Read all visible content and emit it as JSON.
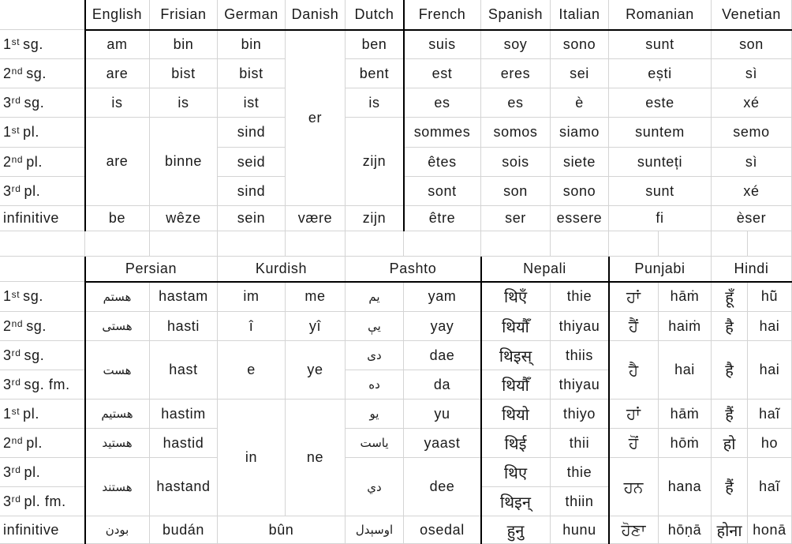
{
  "table1": {
    "row_labels": [
      {
        "num": "1",
        "sup": "st",
        "rest": "sg."
      },
      {
        "num": "2",
        "sup": "nd",
        "rest": "sg."
      },
      {
        "num": "3",
        "sup": "rd",
        "rest": "sg."
      },
      {
        "num": "1",
        "sup": "st",
        "rest": "pl."
      },
      {
        "num": "2",
        "sup": "nd",
        "rest": "pl."
      },
      {
        "num": "3",
        "sup": "rd",
        "rest": "pl."
      },
      {
        "num": "",
        "sup": "",
        "rest": "infinitive"
      }
    ],
    "headers": [
      "English",
      "Frisian",
      "German",
      "Danish",
      "Dutch",
      "French",
      "Spanish",
      "Italian",
      "Romanian",
      "Venetian"
    ],
    "cells": [
      {
        "r": 0,
        "c": 0,
        "rs": 1,
        "v": "am"
      },
      {
        "r": 1,
        "c": 0,
        "rs": 1,
        "v": "are"
      },
      {
        "r": 2,
        "c": 0,
        "rs": 1,
        "v": "is"
      },
      {
        "r": 3,
        "c": 0,
        "rs": 3,
        "v": "are"
      },
      {
        "r": 6,
        "c": 0,
        "rs": 1,
        "v": "be"
      },
      {
        "r": 0,
        "c": 1,
        "rs": 1,
        "v": "bin"
      },
      {
        "r": 1,
        "c": 1,
        "rs": 1,
        "v": "bist"
      },
      {
        "r": 2,
        "c": 1,
        "rs": 1,
        "v": "is"
      },
      {
        "r": 3,
        "c": 1,
        "rs": 3,
        "v": "binne"
      },
      {
        "r": 6,
        "c": 1,
        "rs": 1,
        "v": "wêze"
      },
      {
        "r": 0,
        "c": 2,
        "rs": 1,
        "v": "bin"
      },
      {
        "r": 1,
        "c": 2,
        "rs": 1,
        "v": "bist"
      },
      {
        "r": 2,
        "c": 2,
        "rs": 1,
        "v": "ist"
      },
      {
        "r": 3,
        "c": 2,
        "rs": 1,
        "v": "sind"
      },
      {
        "r": 4,
        "c": 2,
        "rs": 1,
        "v": "seid"
      },
      {
        "r": 5,
        "c": 2,
        "rs": 1,
        "v": "sind"
      },
      {
        "r": 6,
        "c": 2,
        "rs": 1,
        "v": "sein"
      },
      {
        "r": 0,
        "c": 3,
        "rs": 6,
        "v": "er"
      },
      {
        "r": 6,
        "c": 3,
        "rs": 1,
        "v": "være"
      },
      {
        "r": 0,
        "c": 4,
        "rs": 1,
        "v": "ben"
      },
      {
        "r": 1,
        "c": 4,
        "rs": 1,
        "v": "bent"
      },
      {
        "r": 2,
        "c": 4,
        "rs": 1,
        "v": "is"
      },
      {
        "r": 3,
        "c": 4,
        "rs": 3,
        "v": "zijn"
      },
      {
        "r": 6,
        "c": 4,
        "rs": 1,
        "v": "zijn"
      },
      {
        "r": 0,
        "c": 5,
        "rs": 1,
        "v": "suis"
      },
      {
        "r": 1,
        "c": 5,
        "rs": 1,
        "v": "est"
      },
      {
        "r": 2,
        "c": 5,
        "rs": 1,
        "v": "es"
      },
      {
        "r": 3,
        "c": 5,
        "rs": 1,
        "v": "sommes"
      },
      {
        "r": 4,
        "c": 5,
        "rs": 1,
        "v": "êtes"
      },
      {
        "r": 5,
        "c": 5,
        "rs": 1,
        "v": "sont"
      },
      {
        "r": 6,
        "c": 5,
        "rs": 1,
        "v": "être"
      },
      {
        "r": 0,
        "c": 6,
        "rs": 1,
        "v": "soy"
      },
      {
        "r": 1,
        "c": 6,
        "rs": 1,
        "v": "eres"
      },
      {
        "r": 2,
        "c": 6,
        "rs": 1,
        "v": "es"
      },
      {
        "r": 3,
        "c": 6,
        "rs": 1,
        "v": "somos"
      },
      {
        "r": 4,
        "c": 6,
        "rs": 1,
        "v": "sois"
      },
      {
        "r": 5,
        "c": 6,
        "rs": 1,
        "v": "son"
      },
      {
        "r": 6,
        "c": 6,
        "rs": 1,
        "v": "ser"
      },
      {
        "r": 0,
        "c": 7,
        "rs": 1,
        "v": "sono"
      },
      {
        "r": 1,
        "c": 7,
        "rs": 1,
        "v": "sei"
      },
      {
        "r": 2,
        "c": 7,
        "rs": 1,
        "v": "è"
      },
      {
        "r": 3,
        "c": 7,
        "rs": 1,
        "v": "siamo"
      },
      {
        "r": 4,
        "c": 7,
        "rs": 1,
        "v": "siete"
      },
      {
        "r": 5,
        "c": 7,
        "rs": 1,
        "v": "sono"
      },
      {
        "r": 6,
        "c": 7,
        "rs": 1,
        "v": "essere"
      },
      {
        "r": 0,
        "c": 8,
        "rs": 1,
        "v": "sunt"
      },
      {
        "r": 1,
        "c": 8,
        "rs": 1,
        "v": "ești"
      },
      {
        "r": 2,
        "c": 8,
        "rs": 1,
        "v": "este"
      },
      {
        "r": 3,
        "c": 8,
        "rs": 1,
        "v": "suntem"
      },
      {
        "r": 4,
        "c": 8,
        "rs": 1,
        "v": "sunteți"
      },
      {
        "r": 5,
        "c": 8,
        "rs": 1,
        "v": "sunt"
      },
      {
        "r": 6,
        "c": 8,
        "rs": 1,
        "v": "fi"
      },
      {
        "r": 0,
        "c": 9,
        "rs": 1,
        "v": "son"
      },
      {
        "r": 1,
        "c": 9,
        "rs": 1,
        "v": "sì"
      },
      {
        "r": 2,
        "c": 9,
        "rs": 1,
        "v": "xé"
      },
      {
        "r": 3,
        "c": 9,
        "rs": 1,
        "v": "semo"
      },
      {
        "r": 4,
        "c": 9,
        "rs": 1,
        "v": "sì"
      },
      {
        "r": 5,
        "c": 9,
        "rs": 1,
        "v": "xé"
      },
      {
        "r": 6,
        "c": 9,
        "rs": 1,
        "v": "èser"
      }
    ]
  },
  "table2": {
    "row_labels": [
      {
        "num": "1",
        "sup": "st",
        "rest": "sg."
      },
      {
        "num": "2",
        "sup": "nd",
        "rest": "sg."
      },
      {
        "num": "3",
        "sup": "rd",
        "rest": "sg."
      },
      {
        "num": "3",
        "sup": "rd",
        "rest": "sg. fm."
      },
      {
        "num": "1",
        "sup": "st",
        "rest": "pl."
      },
      {
        "num": "2",
        "sup": "nd",
        "rest": "pl."
      },
      {
        "num": "3",
        "sup": "rd",
        "rest": "pl."
      },
      {
        "num": "3",
        "sup": "rd",
        "rest": "pl. fm."
      },
      {
        "num": "",
        "sup": "",
        "rest": "infinitive"
      }
    ],
    "headers": [
      "Persian",
      "Kurdish",
      "Pashto",
      "Nepali",
      "Punjabi",
      "Hindi"
    ],
    "cells": [
      {
        "r": 0,
        "c": 0,
        "rs": 1,
        "cs": 1,
        "v": "هستم",
        "s": "arab"
      },
      {
        "r": 1,
        "c": 0,
        "rs": 1,
        "cs": 1,
        "v": "هستی",
        "s": "arab"
      },
      {
        "r": 2,
        "c": 0,
        "rs": 2,
        "cs": 1,
        "v": "هست",
        "s": "arab"
      },
      {
        "r": 4,
        "c": 0,
        "rs": 1,
        "cs": 1,
        "v": "هستیم",
        "s": "arab"
      },
      {
        "r": 5,
        "c": 0,
        "rs": 1,
        "cs": 1,
        "v": "هستید",
        "s": "arab"
      },
      {
        "r": 6,
        "c": 0,
        "rs": 2,
        "cs": 1,
        "v": "هستند",
        "s": "arab"
      },
      {
        "r": 8,
        "c": 0,
        "rs": 1,
        "cs": 1,
        "v": "بودن",
        "s": "arab"
      },
      {
        "r": 0,
        "c": 1,
        "rs": 1,
        "cs": 1,
        "v": "hastam"
      },
      {
        "r": 1,
        "c": 1,
        "rs": 1,
        "cs": 1,
        "v": "hasti"
      },
      {
        "r": 2,
        "c": 1,
        "rs": 2,
        "cs": 1,
        "v": "hast"
      },
      {
        "r": 4,
        "c": 1,
        "rs": 1,
        "cs": 1,
        "v": "hastim"
      },
      {
        "r": 5,
        "c": 1,
        "rs": 1,
        "cs": 1,
        "v": "hastid"
      },
      {
        "r": 6,
        "c": 1,
        "rs": 2,
        "cs": 1,
        "v": "hastand"
      },
      {
        "r": 8,
        "c": 1,
        "rs": 1,
        "cs": 1,
        "v": "budán"
      },
      {
        "r": 0,
        "c": 2,
        "rs": 1,
        "cs": 1,
        "v": "im"
      },
      {
        "r": 1,
        "c": 2,
        "rs": 1,
        "cs": 1,
        "v": "î"
      },
      {
        "r": 2,
        "c": 2,
        "rs": 2,
        "cs": 1,
        "v": "e"
      },
      {
        "r": 4,
        "c": 2,
        "rs": 4,
        "cs": 1,
        "v": "in"
      },
      {
        "r": 8,
        "c": 2,
        "rs": 1,
        "cs": 2,
        "v": "bûn"
      },
      {
        "r": 0,
        "c": 3,
        "rs": 1,
        "cs": 1,
        "v": "me"
      },
      {
        "r": 1,
        "c": 3,
        "rs": 1,
        "cs": 1,
        "v": "yî"
      },
      {
        "r": 2,
        "c": 3,
        "rs": 2,
        "cs": 1,
        "v": "ye"
      },
      {
        "r": 4,
        "c": 3,
        "rs": 4,
        "cs": 1,
        "v": "ne"
      },
      {
        "r": 0,
        "c": 4,
        "rs": 1,
        "cs": 1,
        "v": "يم",
        "s": "arab"
      },
      {
        "r": 1,
        "c": 4,
        "rs": 1,
        "cs": 1,
        "v": "يې",
        "s": "arab"
      },
      {
        "r": 2,
        "c": 4,
        "rs": 1,
        "cs": 1,
        "v": "دی",
        "s": "arab"
      },
      {
        "r": 3,
        "c": 4,
        "rs": 1,
        "cs": 1,
        "v": "ده",
        "s": "arab"
      },
      {
        "r": 4,
        "c": 4,
        "rs": 1,
        "cs": 1,
        "v": "يو",
        "s": "arab"
      },
      {
        "r": 5,
        "c": 4,
        "rs": 1,
        "cs": 1,
        "v": "ياست",
        "s": "arab"
      },
      {
        "r": 6,
        "c": 4,
        "rs": 2,
        "cs": 1,
        "v": "دي",
        "s": "arab"
      },
      {
        "r": 8,
        "c": 4,
        "rs": 1,
        "cs": 1,
        "v": "اوسېدل",
        "s": "arab"
      },
      {
        "r": 0,
        "c": 5,
        "rs": 1,
        "cs": 1,
        "v": "yam"
      },
      {
        "r": 1,
        "c": 5,
        "rs": 1,
        "cs": 1,
        "v": "yay"
      },
      {
        "r": 2,
        "c": 5,
        "rs": 1,
        "cs": 1,
        "v": "dae"
      },
      {
        "r": 3,
        "c": 5,
        "rs": 1,
        "cs": 1,
        "v": "da"
      },
      {
        "r": 4,
        "c": 5,
        "rs": 1,
        "cs": 1,
        "v": "yu"
      },
      {
        "r": 5,
        "c": 5,
        "rs": 1,
        "cs": 1,
        "v": "yaast"
      },
      {
        "r": 6,
        "c": 5,
        "rs": 2,
        "cs": 1,
        "v": "dee"
      },
      {
        "r": 8,
        "c": 5,
        "rs": 1,
        "cs": 1,
        "v": "osedal"
      },
      {
        "r": 0,
        "c": 6,
        "rs": 1,
        "cs": 1,
        "v": "थिएँ",
        "s": "deva"
      },
      {
        "r": 1,
        "c": 6,
        "rs": 1,
        "cs": 1,
        "v": "थियौँ",
        "s": "deva"
      },
      {
        "r": 2,
        "c": 6,
        "rs": 1,
        "cs": 1,
        "v": "थिइस्",
        "s": "deva"
      },
      {
        "r": 3,
        "c": 6,
        "rs": 1,
        "cs": 1,
        "v": "थियौँ",
        "s": "deva"
      },
      {
        "r": 4,
        "c": 6,
        "rs": 1,
        "cs": 1,
        "v": "थियो",
        "s": "deva"
      },
      {
        "r": 5,
        "c": 6,
        "rs": 1,
        "cs": 1,
        "v": "थिई",
        "s": "deva"
      },
      {
        "r": 6,
        "c": 6,
        "rs": 1,
        "cs": 1,
        "v": "थिए",
        "s": "deva"
      },
      {
        "r": 7,
        "c": 6,
        "rs": 1,
        "cs": 1,
        "v": "थिइन्",
        "s": "deva"
      },
      {
        "r": 8,
        "c": 6,
        "rs": 1,
        "cs": 1,
        "v": "हुनु",
        "s": "deva"
      },
      {
        "r": 0,
        "c": 7,
        "rs": 1,
        "cs": 1,
        "v": "thie"
      },
      {
        "r": 1,
        "c": 7,
        "rs": 1,
        "cs": 1,
        "v": "thiyau"
      },
      {
        "r": 2,
        "c": 7,
        "rs": 1,
        "cs": 1,
        "v": "thiis"
      },
      {
        "r": 3,
        "c": 7,
        "rs": 1,
        "cs": 1,
        "v": "thiyau"
      },
      {
        "r": 4,
        "c": 7,
        "rs": 1,
        "cs": 1,
        "v": "thiyo"
      },
      {
        "r": 5,
        "c": 7,
        "rs": 1,
        "cs": 1,
        "v": "thii"
      },
      {
        "r": 6,
        "c": 7,
        "rs": 1,
        "cs": 1,
        "v": "thie"
      },
      {
        "r": 7,
        "c": 7,
        "rs": 1,
        "cs": 1,
        "v": "thiin"
      },
      {
        "r": 8,
        "c": 7,
        "rs": 1,
        "cs": 1,
        "v": "hunu"
      },
      {
        "r": 0,
        "c": 8,
        "rs": 1,
        "cs": 1,
        "v": "ਹਾਂ",
        "s": "deva"
      },
      {
        "r": 1,
        "c": 8,
        "rs": 1,
        "cs": 1,
        "v": "ਹੈਂ",
        "s": "deva"
      },
      {
        "r": 2,
        "c": 8,
        "rs": 2,
        "cs": 1,
        "v": "ਹੈ",
        "s": "deva"
      },
      {
        "r": 4,
        "c": 8,
        "rs": 1,
        "cs": 1,
        "v": "ਹਾਂ",
        "s": "deva"
      },
      {
        "r": 5,
        "c": 8,
        "rs": 1,
        "cs": 1,
        "v": "ਹੋਂ",
        "s": "deva"
      },
      {
        "r": 6,
        "c": 8,
        "rs": 2,
        "cs": 1,
        "v": "ਹਨ",
        "s": "deva"
      },
      {
        "r": 8,
        "c": 8,
        "rs": 1,
        "cs": 1,
        "v": "ਹੋਣਾ",
        "s": "deva"
      },
      {
        "r": 0,
        "c": 9,
        "rs": 1,
        "cs": 1,
        "v": "hāṁ"
      },
      {
        "r": 1,
        "c": 9,
        "rs": 1,
        "cs": 1,
        "v": "haiṁ"
      },
      {
        "r": 2,
        "c": 9,
        "rs": 2,
        "cs": 1,
        "v": "hai"
      },
      {
        "r": 4,
        "c": 9,
        "rs": 1,
        "cs": 1,
        "v": "hāṁ"
      },
      {
        "r": 5,
        "c": 9,
        "rs": 1,
        "cs": 1,
        "v": "hōṁ"
      },
      {
        "r": 6,
        "c": 9,
        "rs": 2,
        "cs": 1,
        "v": "hana"
      },
      {
        "r": 8,
        "c": 9,
        "rs": 1,
        "cs": 1,
        "v": "hōṇā"
      },
      {
        "r": 0,
        "c": 10,
        "rs": 1,
        "cs": 1,
        "v": "हूँ",
        "s": "deva"
      },
      {
        "r": 1,
        "c": 10,
        "rs": 1,
        "cs": 1,
        "v": "है",
        "s": "deva"
      },
      {
        "r": 2,
        "c": 10,
        "rs": 2,
        "cs": 1,
        "v": "है",
        "s": "deva"
      },
      {
        "r": 4,
        "c": 10,
        "rs": 1,
        "cs": 1,
        "v": "हैं",
        "s": "deva"
      },
      {
        "r": 5,
        "c": 10,
        "rs": 1,
        "cs": 1,
        "v": "हो",
        "s": "deva"
      },
      {
        "r": 6,
        "c": 10,
        "rs": 2,
        "cs": 1,
        "v": "हैं",
        "s": "deva"
      },
      {
        "r": 8,
        "c": 10,
        "rs": 1,
        "cs": 1,
        "v": "होना",
        "s": "deva"
      },
      {
        "r": 0,
        "c": 11,
        "rs": 1,
        "cs": 1,
        "v": "hū̃"
      },
      {
        "r": 1,
        "c": 11,
        "rs": 1,
        "cs": 1,
        "v": "hai"
      },
      {
        "r": 2,
        "c": 11,
        "rs": 2,
        "cs": 1,
        "v": "hai"
      },
      {
        "r": 4,
        "c": 11,
        "rs": 1,
        "cs": 1,
        "v": "haĩ"
      },
      {
        "r": 5,
        "c": 11,
        "rs": 1,
        "cs": 1,
        "v": "ho"
      },
      {
        "r": 6,
        "c": 11,
        "rs": 2,
        "cs": 1,
        "v": "haĩ"
      },
      {
        "r": 8,
        "c": 11,
        "rs": 1,
        "cs": 1,
        "v": "honā"
      }
    ]
  }
}
